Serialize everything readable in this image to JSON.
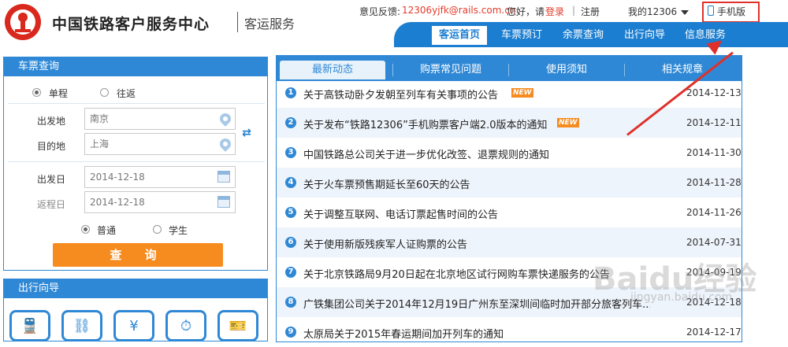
{
  "header": {
    "brand": "中国铁路客户服务中心",
    "sub": "客运服务",
    "feedback_label": "意见反馈:",
    "feedback_email": "12306yjfk@rails.com.cn",
    "greeting": "您好，请",
    "login": "登录",
    "separator": "|",
    "register": "注册",
    "my12306": "我的12306",
    "mobile": "手机版"
  },
  "nav": [
    "客运首页",
    "车票预订",
    "余票查询",
    "出行向导",
    "信息服务"
  ],
  "ticket_query": {
    "title": "车票查询",
    "oneway": "单程",
    "roundtrip": "往返",
    "from_label": "出发地",
    "from_value": "南京",
    "to_label": "目的地",
    "to_value": "上海",
    "depart_label": "出发日",
    "depart_value": "2014-12-18",
    "return_label": "返程日",
    "return_value": "2014-12-18",
    "normal": "普通",
    "student": "学生",
    "query_button": "查 询"
  },
  "guide": {
    "title": "出行向导"
  },
  "tabs": [
    "最新动态",
    "购票常见问题",
    "使用须知",
    "相关规章"
  ],
  "news": [
    {
      "num": "1",
      "title": "关于高铁动卧夕发朝至列车有关事项的公告",
      "badge": "NEW",
      "date": "2014-12-13"
    },
    {
      "num": "2",
      "title": "关于发布“铁路12306”手机购票客户端2.0版本的通知",
      "badge": "NEW",
      "date": "2014-12-11"
    },
    {
      "num": "3",
      "title": "中国铁路总公司关于进一步优化改签、退票规则的通知",
      "badge": "",
      "date": "2014-11-30"
    },
    {
      "num": "4",
      "title": "关于火车票预售期延长至60天的公告",
      "badge": "",
      "date": "2014-11-28"
    },
    {
      "num": "5",
      "title": "关于调整互联网、电话订票起售时间的公告",
      "badge": "",
      "date": "2014-11-26"
    },
    {
      "num": "6",
      "title": "关于使用新版残疾军人证购票的公告",
      "badge": "",
      "date": "2014-07-31"
    },
    {
      "num": "7",
      "title": "关于北京铁路局9月20日起在北京地区试行网购车票快递服务的公告",
      "badge": "",
      "date": "2014-09-19"
    },
    {
      "num": "8",
      "title": "广铁集团公司关于2014年12月19日广州东至深圳间临时加开部分旅客列车...",
      "badge": "",
      "date": "2014-12-18"
    },
    {
      "num": "9",
      "title": "太原局关于2015年春运期间加开列车的通知",
      "badge": "",
      "date": "2014-12-17"
    }
  ],
  "watermark": {
    "main": "Baidu经验",
    "sub": "jingyan.baidu.com"
  },
  "colors": {
    "primary": "#1b7ed0",
    "accent": "#f68b1f",
    "alert": "#e0302a"
  }
}
